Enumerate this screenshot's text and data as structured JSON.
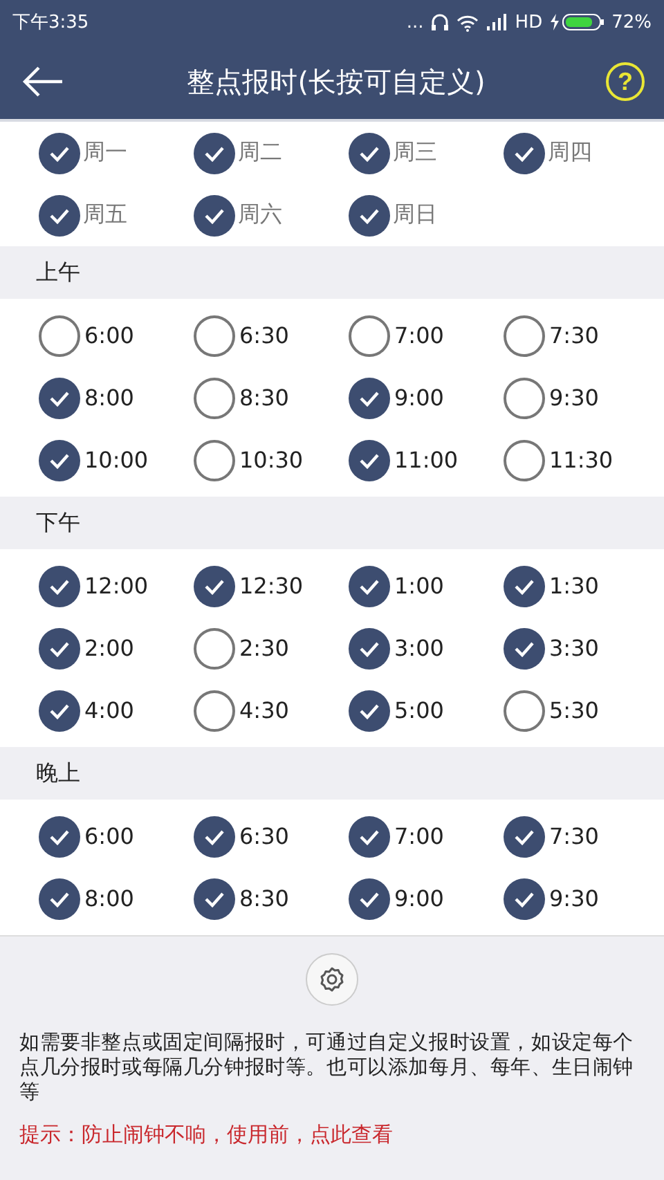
{
  "status_bar": {
    "time": "下午3:35",
    "dots": "...",
    "network": "HD",
    "battery_text": "72%"
  },
  "header": {
    "title": "整点报时(长按可自定义)",
    "help": "?"
  },
  "days": [
    {
      "label": "周一",
      "checked": true
    },
    {
      "label": "周二",
      "checked": true
    },
    {
      "label": "周三",
      "checked": true
    },
    {
      "label": "周四",
      "checked": true
    },
    {
      "label": "周五",
      "checked": true
    },
    {
      "label": "周六",
      "checked": true
    },
    {
      "label": "周日",
      "checked": true
    }
  ],
  "sections": [
    {
      "title": "上午",
      "times": [
        {
          "label": "6:00",
          "checked": false
        },
        {
          "label": "6:30",
          "checked": false
        },
        {
          "label": "7:00",
          "checked": false
        },
        {
          "label": "7:30",
          "checked": false
        },
        {
          "label": "8:00",
          "checked": true
        },
        {
          "label": "8:30",
          "checked": false
        },
        {
          "label": "9:00",
          "checked": true
        },
        {
          "label": "9:30",
          "checked": false
        },
        {
          "label": "10:00",
          "checked": true
        },
        {
          "label": "10:30",
          "checked": false
        },
        {
          "label": "11:00",
          "checked": true
        },
        {
          "label": "11:30",
          "checked": false
        }
      ]
    },
    {
      "title": "下午",
      "times": [
        {
          "label": "12:00",
          "checked": true
        },
        {
          "label": "12:30",
          "checked": true
        },
        {
          "label": "1:00",
          "checked": true
        },
        {
          "label": "1:30",
          "checked": true
        },
        {
          "label": "2:00",
          "checked": true
        },
        {
          "label": "2:30",
          "checked": false
        },
        {
          "label": "3:00",
          "checked": true
        },
        {
          "label": "3:30",
          "checked": true
        },
        {
          "label": "4:00",
          "checked": true
        },
        {
          "label": "4:30",
          "checked": false
        },
        {
          "label": "5:00",
          "checked": true
        },
        {
          "label": "5:30",
          "checked": false
        }
      ]
    },
    {
      "title": "晚上",
      "times": [
        {
          "label": "6:00",
          "checked": true
        },
        {
          "label": "6:30",
          "checked": true
        },
        {
          "label": "7:00",
          "checked": true
        },
        {
          "label": "7:30",
          "checked": true
        },
        {
          "label": "8:00",
          "checked": true
        },
        {
          "label": "8:30",
          "checked": true
        },
        {
          "label": "9:00",
          "checked": true
        },
        {
          "label": "9:30",
          "checked": true
        }
      ]
    }
  ],
  "footer": {
    "info": "如需要非整点或固定间隔报时，可通过自定义报时设置，如设定每个点几分报时或每隔几分钟报时等。也可以添加每月、每年、生日闹钟等",
    "tip": "提示：防止闹钟不响，使用前，点此查看"
  }
}
